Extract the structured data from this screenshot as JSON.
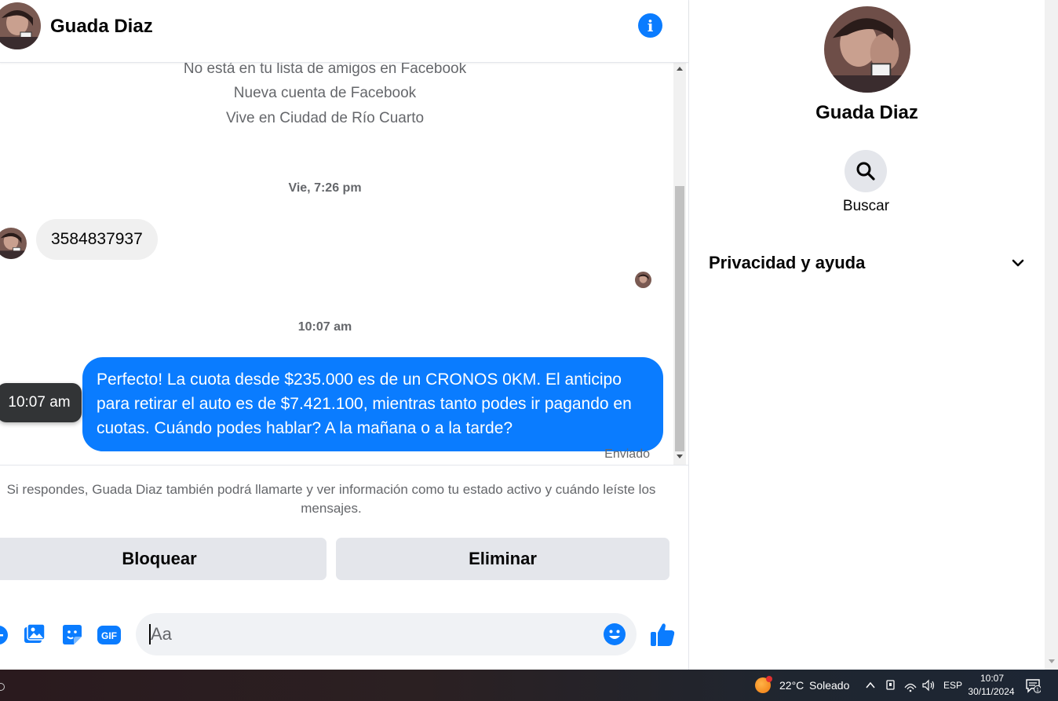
{
  "contact": {
    "name": "Guada Diaz"
  },
  "chat": {
    "profile_info": [
      "No está en tu lista de amigos en Facebook",
      "Nueva cuenta de Facebook",
      "Vive en Ciudad de Río Cuarto"
    ],
    "timestamp_1": "Vie, 7:26 pm",
    "incoming_message": "3584837937",
    "timestamp_2": "10:07 am",
    "outgoing_message": "Perfecto! La cuota desde $235.000 es de un CRONOS 0KM. El anticipo para retirar el auto es de $7.421.100, mientras tanto podes ir pagando en cuotas. Cuándo podes hablar? A la mañana o a la tarde?",
    "tooltip_time": "10:07 am",
    "sent_status": "Enviado",
    "notice": "Si respondes, Guada Diaz también podrá llamarte y ver información como tu estado activo y cuándo leíste los mensajes.",
    "block_label": "Bloquear",
    "delete_label": "Eliminar"
  },
  "composer": {
    "placeholder": "Aa",
    "icons": [
      "plus-icon",
      "photo-icon",
      "sticker-icon",
      "gif-icon",
      "emoji-icon",
      "like-icon"
    ],
    "gif_text": "GIF"
  },
  "right_panel": {
    "name": "Guada Diaz",
    "search_label": "Buscar",
    "privacy_label": "Privacidad y ayuda"
  },
  "taskbar": {
    "temperature": "22°C",
    "condition": "Soleado",
    "language": "ESP",
    "time": "10:07",
    "date": "30/11/2024",
    "notification_count": "1"
  },
  "colors": {
    "accent": "#0a7cff",
    "bubble_in": "#f0f0f0",
    "button_bg": "#e4e6eb",
    "secondary_text": "#65676b"
  }
}
